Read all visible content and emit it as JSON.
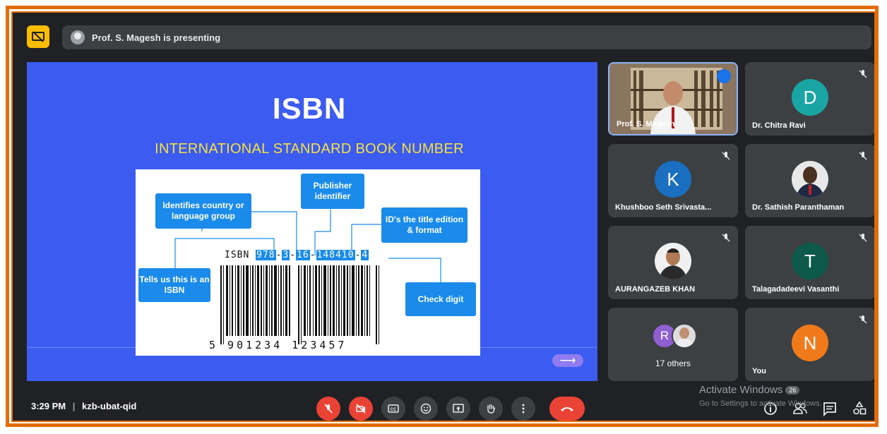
{
  "presenter_bar": {
    "text": "Prof. S. Magesh is presenting"
  },
  "slide": {
    "title": "ISBN",
    "subtitle": "INTERNATIONAL STANDARD BOOK NUMBER",
    "boxes": {
      "country": "Identifies country or language group",
      "publisher": "Publisher identifier",
      "title_id": "ID's the title edition & format",
      "isbn_tag": "Tells us this is an ISBN",
      "check": "Check digit"
    },
    "isbn_prefix": "ISBN",
    "isbn_parts": [
      "978",
      "3",
      "16",
      "148410",
      "4"
    ],
    "barcode_digits": "5 901234 123457",
    "next_arrow": "⟶"
  },
  "participants": [
    {
      "name": "Prof. S. Magesh",
      "type": "video",
      "speaking": true
    },
    {
      "name": "Dr. Chitra Ravi",
      "initial": "D",
      "color": "#1aa5a5",
      "muted": true
    },
    {
      "name": "Khushboo Seth Srivasta...",
      "initial": "K",
      "color": "#1a6fc0",
      "muted": true
    },
    {
      "name": "Dr. Sathish Paranthaman",
      "type": "photo",
      "muted": true
    },
    {
      "name": "AURANGAZEB KHAN",
      "type": "photo",
      "muted": true
    },
    {
      "name": "Talagadadeevi Vasanthi",
      "initial": "T",
      "color": "#0d5a4a",
      "muted": true
    },
    {
      "name": "17 others",
      "initial": "R",
      "color": "#8e5fd0"
    },
    {
      "name": "You",
      "initial": "N",
      "color": "#f07a1a",
      "muted": true
    }
  ],
  "bottom": {
    "time": "3:29 PM",
    "separator": "|",
    "meeting_code": "kzb-ubat-qid"
  },
  "watermark": {
    "line1": "Activate Windows",
    "badge": "26",
    "line2": "Go to Settings to activate Windows."
  }
}
